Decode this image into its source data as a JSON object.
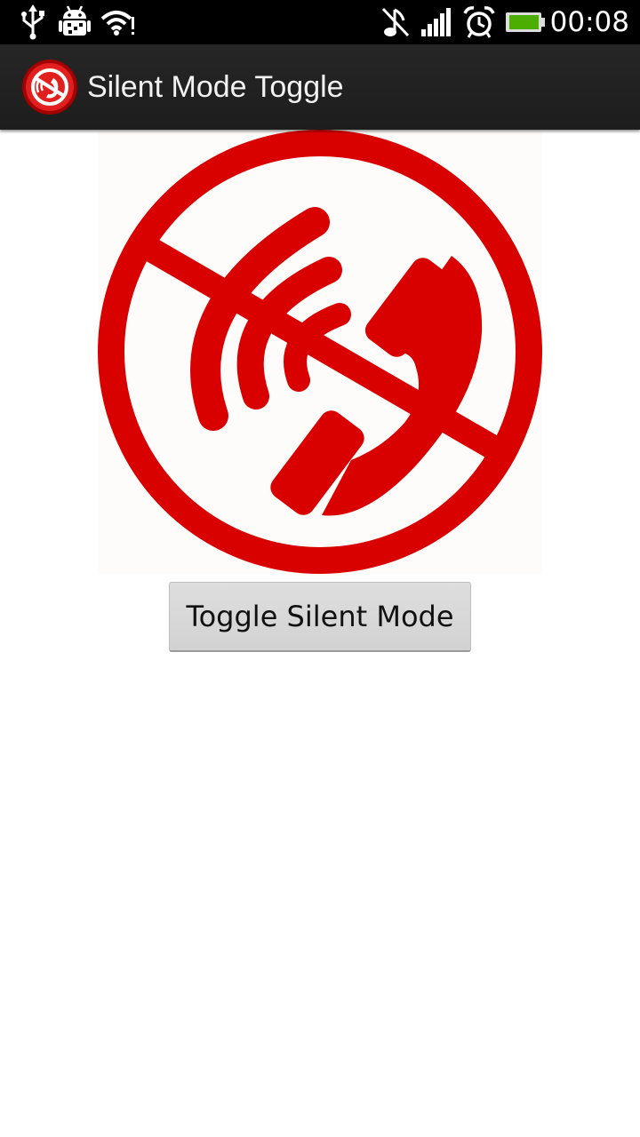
{
  "status_bar": {
    "time": "00:08",
    "icons": [
      "usb-icon",
      "android-debug-icon",
      "wifi-icon",
      "music-muted-icon",
      "signal-icon",
      "alarm-icon",
      "battery-icon"
    ],
    "battery_color": "#4caf00"
  },
  "action_bar": {
    "title": "Silent Mode Toggle",
    "icon": "silent-phone-app-icon"
  },
  "main": {
    "image": "silent-phone-icon",
    "toggle_button_label": "Toggle Silent Mode"
  },
  "colors": {
    "accent_red": "#d90000",
    "action_bar_bg": "#222222",
    "button_bg": "#d6d6d6"
  }
}
